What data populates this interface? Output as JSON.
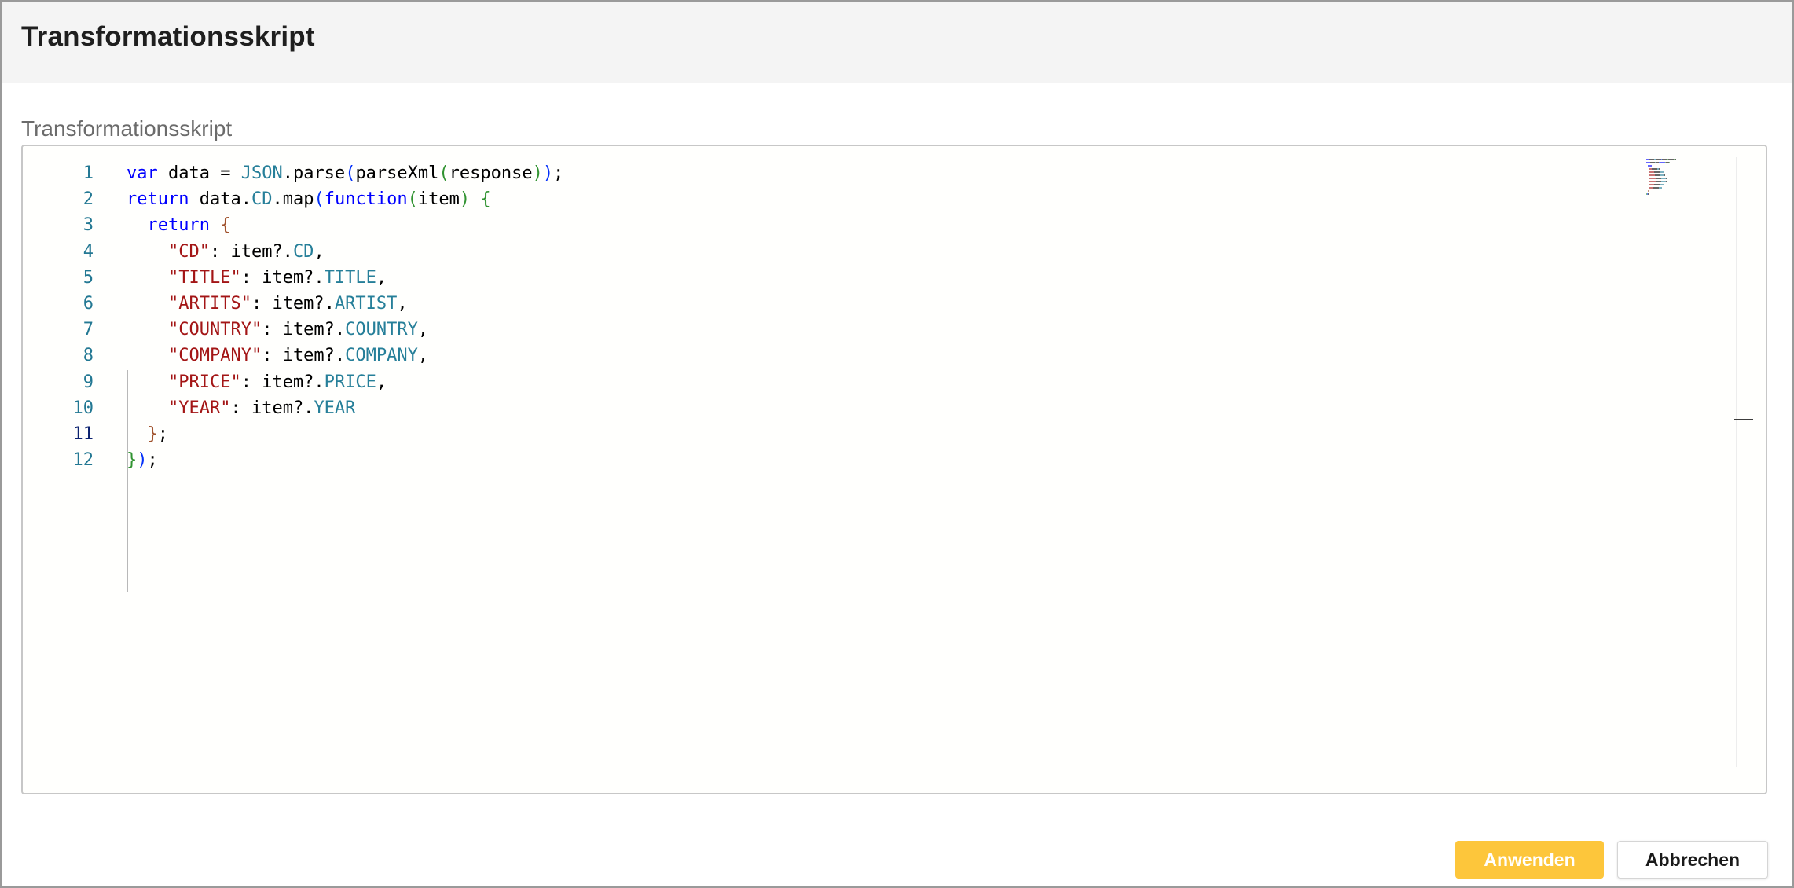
{
  "dialog": {
    "title": "Transformationsskript"
  },
  "field": {
    "label": "Transformationsskript"
  },
  "editor": {
    "active_line": 11,
    "line_numbers": [
      "1",
      "2",
      "3",
      "4",
      "5",
      "6",
      "7",
      "8",
      "9",
      "10",
      "11",
      "12"
    ],
    "lines": [
      [
        {
          "t": "var",
          "c": "keyword"
        },
        {
          "t": " data = ",
          "c": "plain"
        },
        {
          "t": "JSON",
          "c": "type"
        },
        {
          "t": ".parse",
          "c": "plain"
        },
        {
          "t": "(",
          "c": "bracket2"
        },
        {
          "t": "parseXml",
          "c": "plain"
        },
        {
          "t": "(",
          "c": "bracket3"
        },
        {
          "t": "response",
          "c": "plain"
        },
        {
          "t": ")",
          "c": "bracket3"
        },
        {
          "t": ")",
          "c": "bracket2"
        },
        {
          "t": ";",
          "c": "plain"
        }
      ],
      [
        {
          "t": "return",
          "c": "keyword"
        },
        {
          "t": " data.",
          "c": "plain"
        },
        {
          "t": "CD",
          "c": "type"
        },
        {
          "t": ".map",
          "c": "plain"
        },
        {
          "t": "(",
          "c": "bracket2"
        },
        {
          "t": "function",
          "c": "keyword"
        },
        {
          "t": "(",
          "c": "bracket3"
        },
        {
          "t": "item",
          "c": "plain"
        },
        {
          "t": ")",
          "c": "bracket3"
        },
        {
          "t": " ",
          "c": "plain"
        },
        {
          "t": "{",
          "c": "bracket3"
        }
      ],
      [
        {
          "t": "  ",
          "c": "plain"
        },
        {
          "t": "return",
          "c": "keyword"
        },
        {
          "t": " ",
          "c": "plain"
        },
        {
          "t": "{",
          "c": "bracket1"
        }
      ],
      [
        {
          "t": "    ",
          "c": "plain"
        },
        {
          "t": "\"CD\"",
          "c": "string"
        },
        {
          "t": ": item?.",
          "c": "plain"
        },
        {
          "t": "CD",
          "c": "type"
        },
        {
          "t": ",",
          "c": "plain"
        }
      ],
      [
        {
          "t": "    ",
          "c": "plain"
        },
        {
          "t": "\"TITLE\"",
          "c": "string"
        },
        {
          "t": ": item?.",
          "c": "plain"
        },
        {
          "t": "TITLE",
          "c": "type"
        },
        {
          "t": ",",
          "c": "plain"
        }
      ],
      [
        {
          "t": "    ",
          "c": "plain"
        },
        {
          "t": "\"ARTITS\"",
          "c": "string"
        },
        {
          "t": ": item?.",
          "c": "plain"
        },
        {
          "t": "ARTIST",
          "c": "type"
        },
        {
          "t": ",",
          "c": "plain"
        }
      ],
      [
        {
          "t": "    ",
          "c": "plain"
        },
        {
          "t": "\"COUNTRY\"",
          "c": "string"
        },
        {
          "t": ": item?.",
          "c": "plain"
        },
        {
          "t": "COUNTRY",
          "c": "type"
        },
        {
          "t": ",",
          "c": "plain"
        }
      ],
      [
        {
          "t": "    ",
          "c": "plain"
        },
        {
          "t": "\"COMPANY\"",
          "c": "string"
        },
        {
          "t": ": item?.",
          "c": "plain"
        },
        {
          "t": "COMPANY",
          "c": "type"
        },
        {
          "t": ",",
          "c": "plain"
        }
      ],
      [
        {
          "t": "    ",
          "c": "plain"
        },
        {
          "t": "\"PRICE\"",
          "c": "string"
        },
        {
          "t": ": item?.",
          "c": "plain"
        },
        {
          "t": "PRICE",
          "c": "type"
        },
        {
          "t": ",",
          "c": "plain"
        }
      ],
      [
        {
          "t": "    ",
          "c": "plain"
        },
        {
          "t": "\"YEAR\"",
          "c": "string"
        },
        {
          "t": ": item?.",
          "c": "plain"
        },
        {
          "t": "YEAR",
          "c": "type"
        }
      ],
      [
        {
          "t": "  ",
          "c": "plain"
        },
        {
          "t": "}",
          "c": "bracket1"
        },
        {
          "t": ";",
          "c": "plain"
        }
      ],
      [
        {
          "t": "}",
          "c": "bracket3"
        },
        {
          "t": ")",
          "c": "bracket2"
        },
        {
          "t": ";",
          "c": "plain"
        }
      ]
    ]
  },
  "colors": {
    "keyword": "#0000ff",
    "plain": "#000000",
    "type": "#267f99",
    "string": "#a31515",
    "bracket1": "#a0522d",
    "bracket2": "#0431fa",
    "bracket3": "#319331",
    "accent": "#fdc63b"
  },
  "buttons": {
    "apply_label": "Anwenden",
    "cancel_label": "Abbrechen"
  }
}
